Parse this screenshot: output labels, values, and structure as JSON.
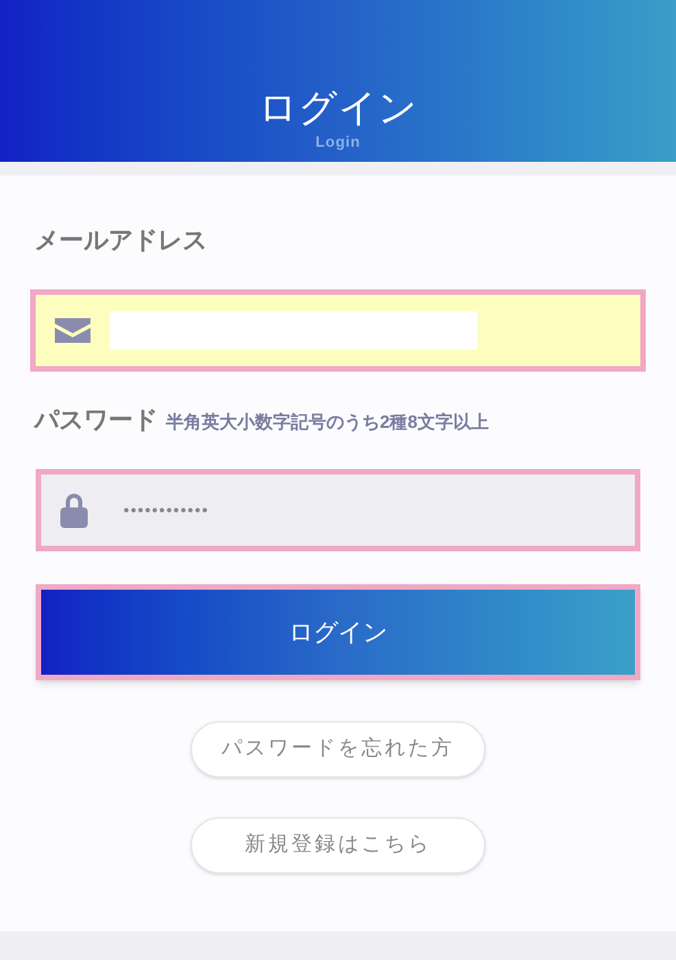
{
  "header": {
    "title": "ログイン",
    "subtitle": "Login"
  },
  "email": {
    "label": "メールアドレス"
  },
  "password": {
    "label": "パスワード",
    "hint": "半角英大小数字記号のうち2種8文字以上",
    "value": "••••••••••••"
  },
  "submit": "ログイン",
  "links": [
    "パスワードを忘れた方",
    "新規登録はこちら"
  ]
}
